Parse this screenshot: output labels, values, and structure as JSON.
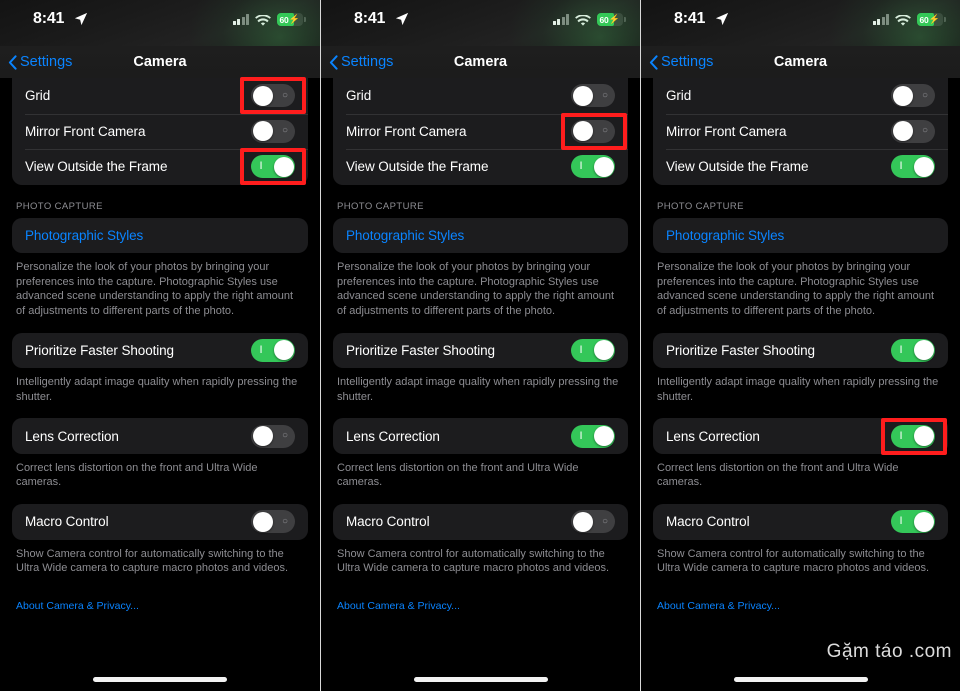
{
  "status_bar": {
    "time": "8:41",
    "location_icon": "location-arrow-icon",
    "signal_icon": "cellular-bars-icon",
    "wifi_icon": "wifi-icon",
    "battery_level": "60",
    "battery_charging_icon": "bolt-icon"
  },
  "nav": {
    "back_icon": "chevron-left-icon",
    "back_label": "Settings",
    "title": "Camera"
  },
  "rows": {
    "grid": "Grid",
    "mirror_front_camera": "Mirror Front Camera",
    "view_outside_the_frame": "View Outside the Frame",
    "photographic_styles": "Photographic Styles",
    "prioritize_faster_shooting": "Prioritize Faster Shooting",
    "lens_correction": "Lens Correction",
    "macro_control": "Macro Control"
  },
  "section_headers": {
    "photo_capture": "PHOTO CAPTURE"
  },
  "descriptions": {
    "photographic_styles": "Personalize the look of your photos by bringing your preferences into the capture. Photographic Styles use advanced scene understanding to apply the right amount of adjustments to different parts of the photo.",
    "prioritize_faster_shooting": "Intelligently adapt image quality when rapidly pressing the shutter.",
    "lens_correction": "Correct lens distortion on the front and Ultra Wide cameras.",
    "macro_control": "Show Camera control for automatically switching to the Ultra Wide camera to capture macro photos and videos."
  },
  "footer": {
    "about_link": "About Camera & Privacy..."
  },
  "toggle_glyphs": {
    "on": "I",
    "off": "○"
  },
  "watermark": "Gặm táo .com",
  "colors": {
    "accent_blue": "#0a84ff",
    "toggle_on_green": "#34c759",
    "toggle_off_gray": "#3f3f41",
    "highlight_red": "#ff1d1d",
    "row_background": "#1c1c1e",
    "screen_background": "#000000",
    "secondary_text": "#8d8d92"
  },
  "panels": [
    {
      "id": "panel-1",
      "toggles": {
        "grid": "off",
        "mirror_front_camera": "off",
        "view_outside_the_frame": "on",
        "prioritize_faster_shooting": "on",
        "lens_correction": "off",
        "macro_control": "off"
      },
      "highlights": [
        "grid",
        "view_outside_the_frame"
      ],
      "watermark_visible": false
    },
    {
      "id": "panel-2",
      "toggles": {
        "grid": "off",
        "mirror_front_camera": "off",
        "view_outside_the_frame": "on",
        "prioritize_faster_shooting": "on",
        "lens_correction": "on",
        "macro_control": "off"
      },
      "highlights": [
        "mirror_front_camera"
      ],
      "watermark_visible": false
    },
    {
      "id": "panel-3",
      "toggles": {
        "grid": "off",
        "mirror_front_camera": "off",
        "view_outside_the_frame": "on",
        "prioritize_faster_shooting": "on",
        "lens_correction": "on",
        "macro_control": "on"
      },
      "highlights": [
        "lens_correction"
      ],
      "watermark_visible": true
    }
  ]
}
